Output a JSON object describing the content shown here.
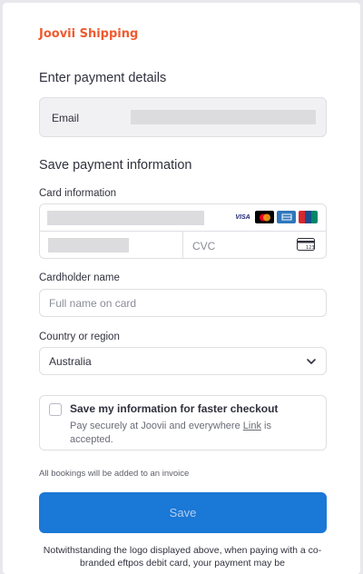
{
  "brand": {
    "name": "Joovii Shipping",
    "color": "#ef5a2f"
  },
  "payment_details": {
    "heading": "Enter payment details",
    "email_label": "Email"
  },
  "save_payment": {
    "heading": "Save payment information",
    "card_label": "Card information",
    "cvc_placeholder": "CVC",
    "card_brands": [
      "VISA",
      "mastercard-icon",
      "amex-icon",
      "unionpay-icon"
    ],
    "cardholder_label": "Cardholder name",
    "cardholder_placeholder": "Full name on card",
    "country_label": "Country or region",
    "country_value": "Australia"
  },
  "save_info": {
    "title": "Save my information for faster checkout",
    "desc_before": "Pay securely at Joovii and everywhere ",
    "desc_link": "Link",
    "desc_after": " is accepted.",
    "checked": false
  },
  "invoice_note": "All bookings will be added to an invoice",
  "save_button": {
    "label": "Save",
    "color": "#1a78d6"
  },
  "footer": "Notwithstanding the logo displayed above, when paying with a co-branded eftpos debit card, your payment may be"
}
